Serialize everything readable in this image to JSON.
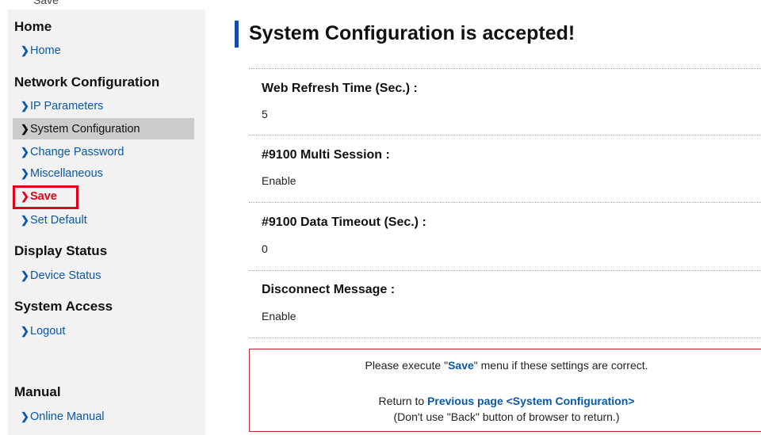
{
  "top_clip": "Save",
  "sidebar": {
    "sections": [
      {
        "title": "Home"
      },
      {
        "title": "Network Configuration"
      },
      {
        "title": "Display Status"
      },
      {
        "title": "System Access"
      },
      {
        "title": "Manual"
      }
    ],
    "items": [
      {
        "label": "Home"
      },
      {
        "label": "IP Parameters"
      },
      {
        "label": "System Configuration"
      },
      {
        "label": "Change Password"
      },
      {
        "label": "Miscellaneous"
      },
      {
        "label": "Save"
      },
      {
        "label": "Set Default"
      },
      {
        "label": "Device Status"
      },
      {
        "label": "Logout"
      },
      {
        "label": "Online Manual"
      }
    ],
    "chevron": "›"
  },
  "main": {
    "title": "System Configuration is accepted!",
    "fields": [
      {
        "label": "Web Refresh Time (Sec.) :",
        "value": "5"
      },
      {
        "label": "#9100 Multi Session :",
        "value": "Enable"
      },
      {
        "label": "#9100 Data Timeout (Sec.) :",
        "value": "0"
      },
      {
        "label": "Disconnect Message :",
        "value": "Enable"
      }
    ]
  },
  "notice": {
    "line1_prefix": "Please execute \"",
    "line1_save": "Save",
    "line1_suffix": "\" menu if these settings are correct.",
    "line2_prefix": "Return to ",
    "line2_link": "Previous page <System Configuration>",
    "line3": "(Don't use \"Back\" button of browser to return.)"
  },
  "colors": {
    "accent_blue": "#0a58a8",
    "title_bar": "#1a4aa8",
    "highlight_red": "#e2001a",
    "notice_border": "#c0282d",
    "sidebar_bg": "#f2f2f2",
    "active_bg": "#cccccc"
  },
  "icons": {
    "nav_chevron": "chevron-right-icon"
  }
}
